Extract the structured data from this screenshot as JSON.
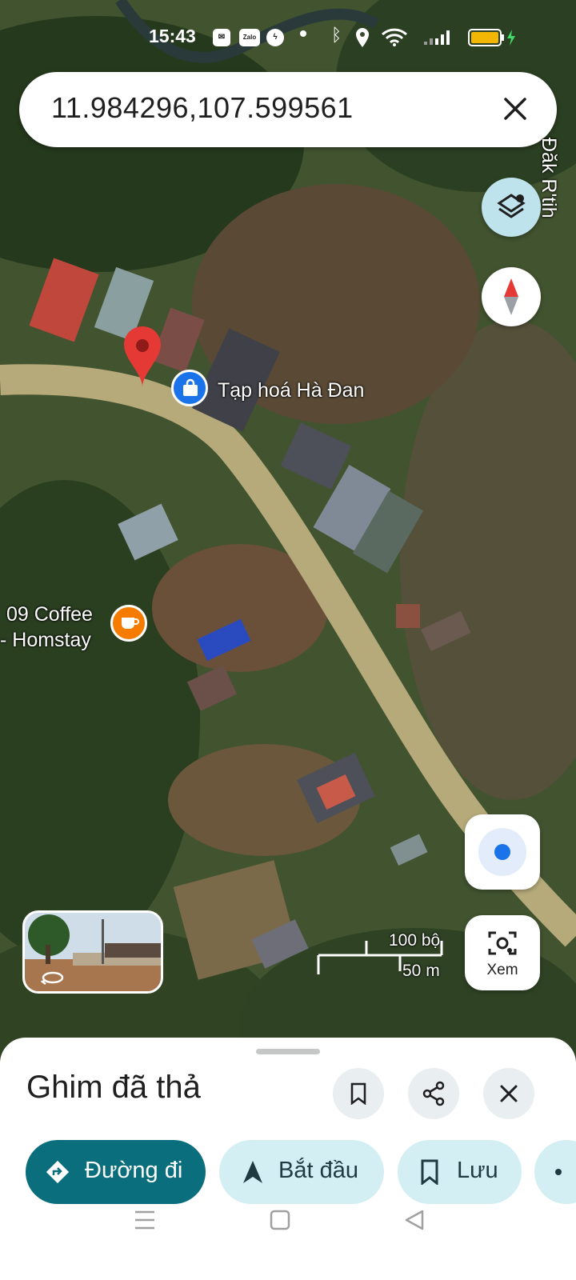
{
  "status_bar": {
    "time": "15:43"
  },
  "search": {
    "query": "11.984296,107.599561"
  },
  "map": {
    "labels": {
      "dak_rtih": "Đăk R'tih",
      "shop": "Tạp hoá Hà Đan",
      "coffee_line1": "09 Coffee",
      "coffee_line2": "- Homstay"
    },
    "scale": {
      "feet": "100 bộ",
      "meters": "50 m"
    },
    "lens_label": "Xem"
  },
  "sheet": {
    "title": "Ghim đã thả",
    "actions": {
      "directions": "Đường đi",
      "start": "Bắt đầu",
      "save": "Lưu"
    }
  },
  "colors": {
    "accent_teal": "#0b6e7d",
    "chip_bg": "#d3eff4",
    "pin_red": "#e53935",
    "shop_blue": "#1a73e8",
    "coffee_orange": "#f57c00"
  }
}
